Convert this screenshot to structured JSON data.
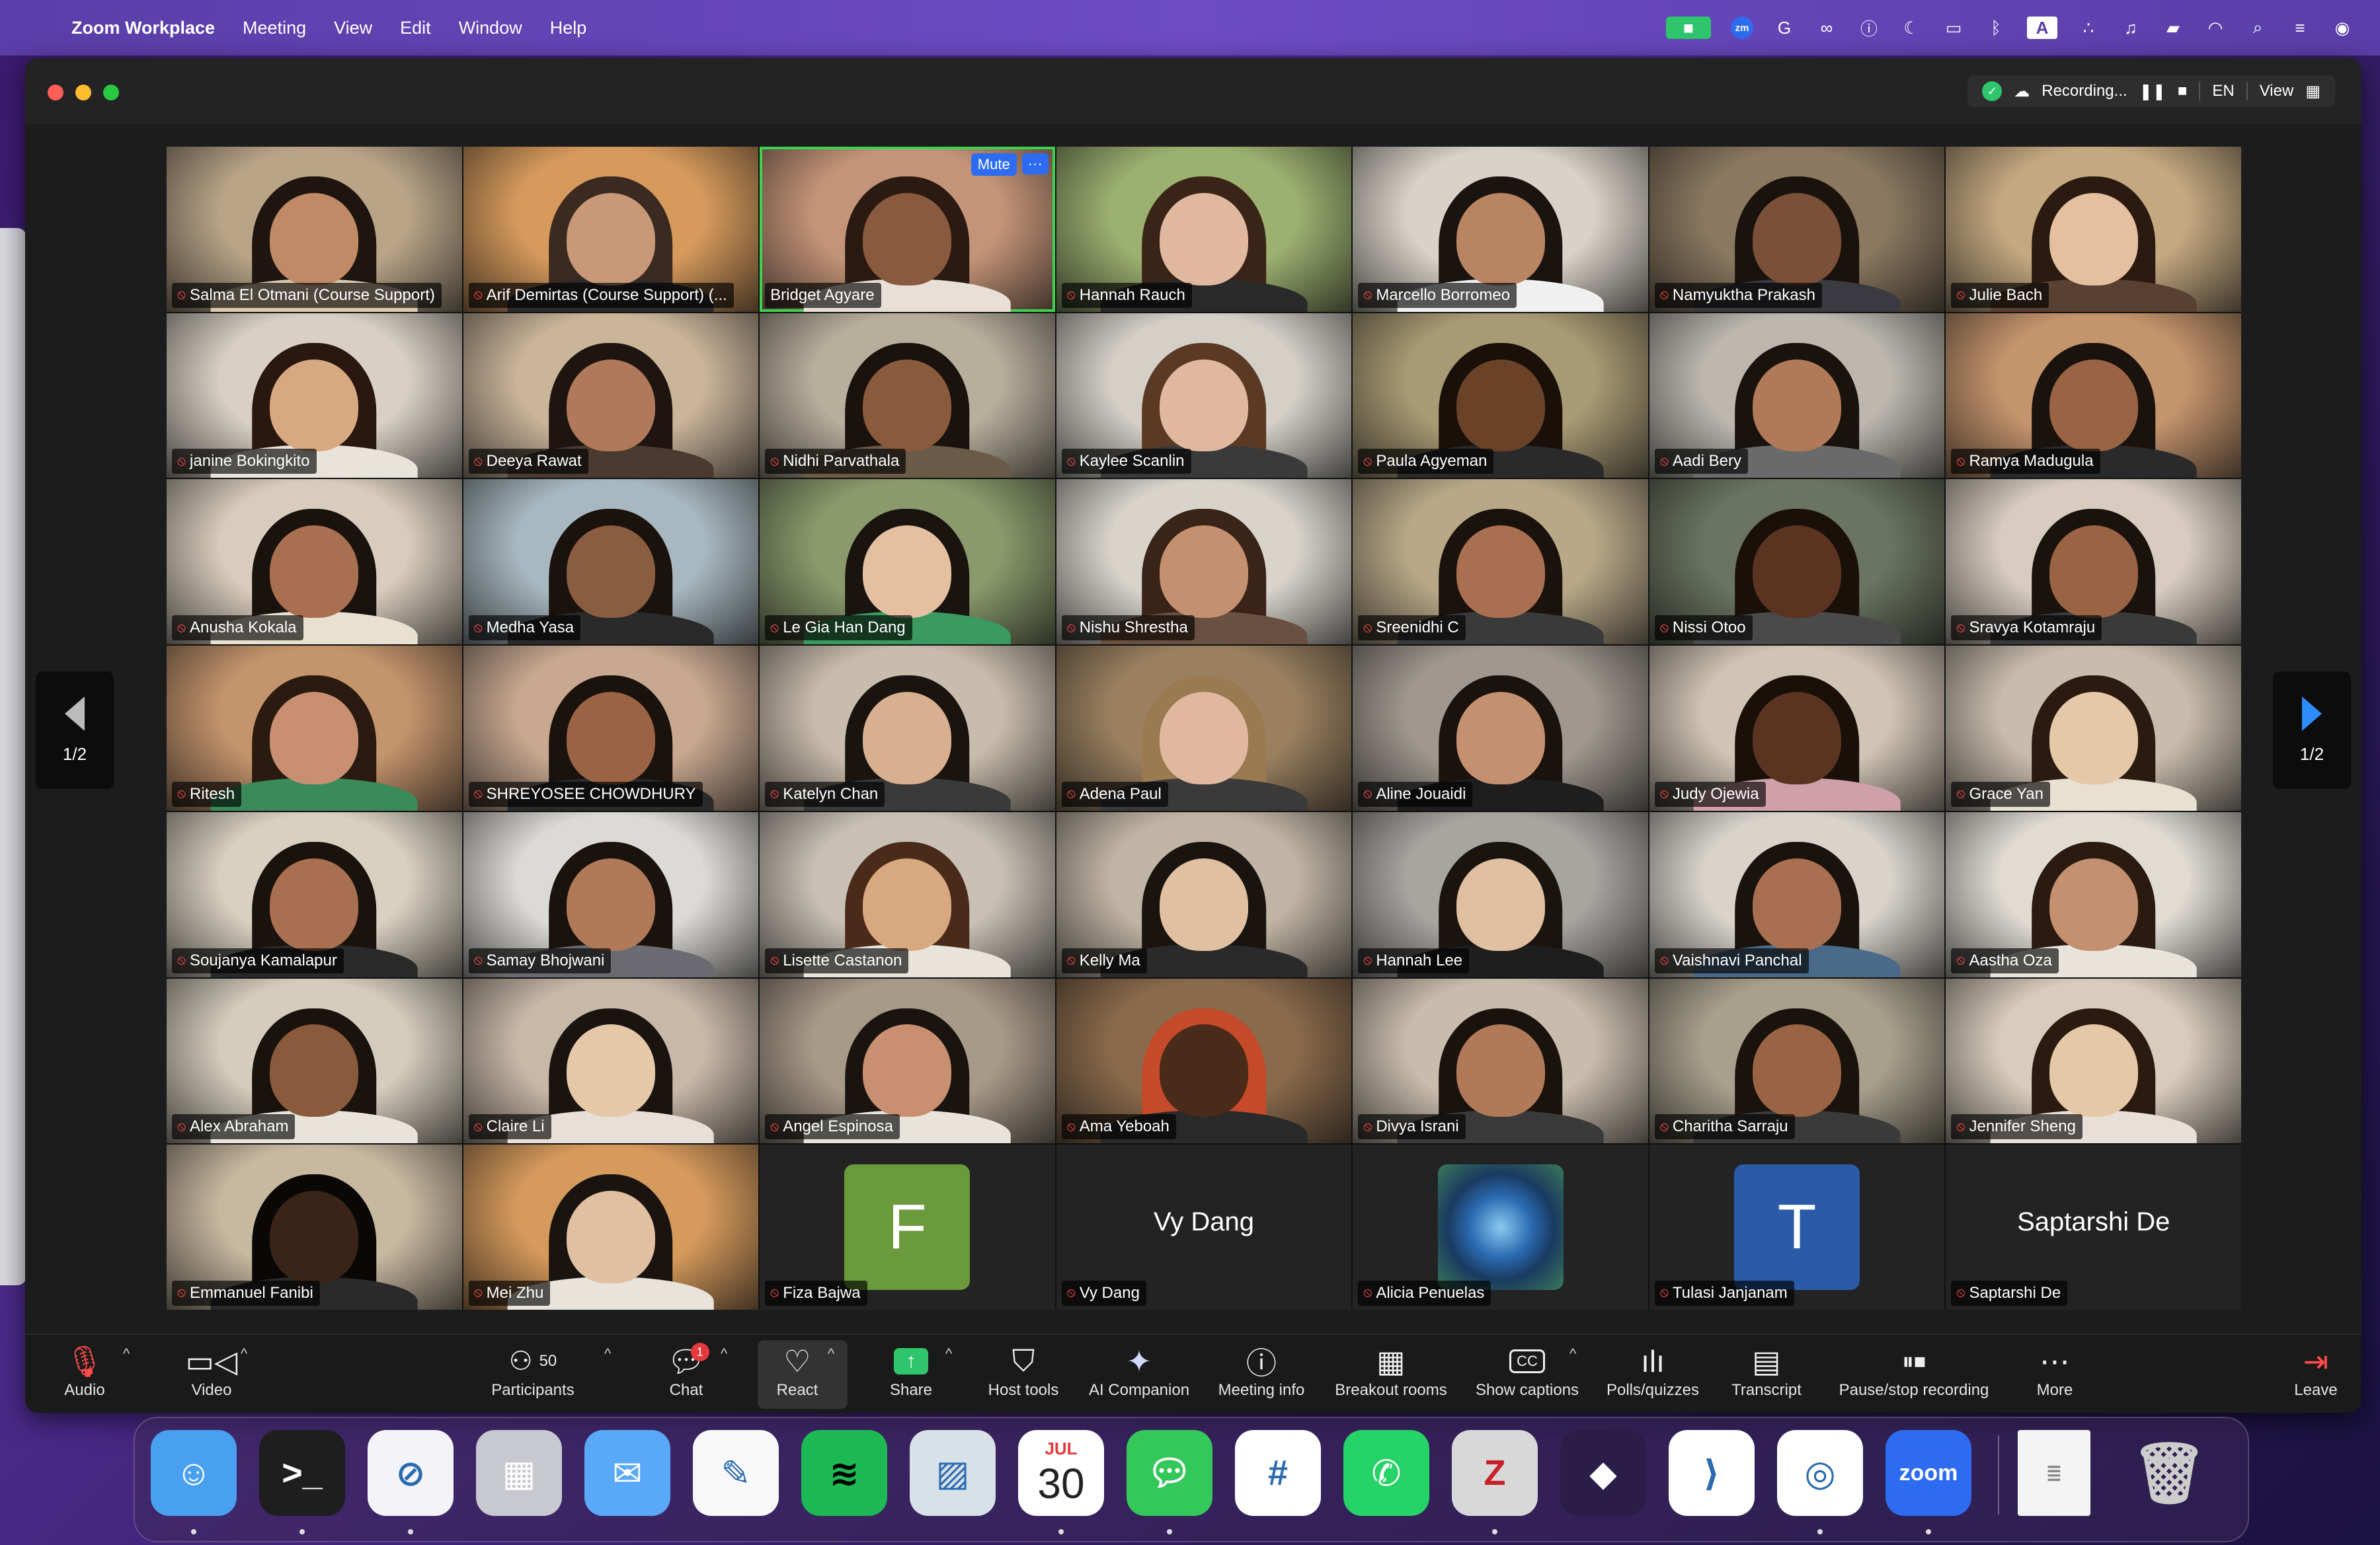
{
  "menubar": {
    "app_name": "Zoom Workplace",
    "menus": [
      "Meeting",
      "View",
      "Edit",
      "Window",
      "Help"
    ],
    "zoom_badge": "zm",
    "keyboard_indicator": "A"
  },
  "window": {
    "recording_label": "Recording...",
    "language": "EN",
    "view_label": "View",
    "page_indicator_left": "1/2",
    "page_indicator_right": "1/2"
  },
  "participants": [
    {
      "name": "Salma El Otmani (Course Support)",
      "bg": "#b9a488",
      "skin": "#c08a66",
      "hair": "#1e1410",
      "shirt": "#d9c9b0"
    },
    {
      "name": "Arif Demirtas (Course Support) (...",
      "bg": "#d69a5c",
      "skin": "#c89878",
      "hair": "#3a2a20",
      "shirt": "#2c2c2c"
    },
    {
      "name": "Bridget Agyare",
      "bg": "#c49478",
      "skin": "#8a5a3e",
      "hair": "#2a1a12",
      "shirt": "#e8e0d8",
      "active": true,
      "mute_label": "Mute",
      "more_label": "···"
    },
    {
      "name": "Hannah Rauch",
      "bg": "#9cb070",
      "skin": "#e0b8a0",
      "hair": "#3a2418",
      "shirt": "#2a2a2a"
    },
    {
      "name": "Marcello Borromeo",
      "bg": "#d8d2c8",
      "skin": "#b88462",
      "hair": "#1a1410",
      "shirt": "#f0f0f0"
    },
    {
      "name": "Namyuktha Prakash",
      "bg": "#8a7860",
      "skin": "#7a5038",
      "hair": "#1a120c",
      "shirt": "#3a3a40"
    },
    {
      "name": "Julie Bach",
      "bg": "#c4a880",
      "skin": "#e4c0a0",
      "hair": "#2a1a10",
      "shirt": "#5a4030"
    },
    {
      "name": "janine Bokingkito",
      "bg": "#d8d0c4",
      "skin": "#d8a880",
      "hair": "#2a1810",
      "shirt": "#e8e4dc"
    },
    {
      "name": "Deeya Rawat",
      "bg": "#cab49a",
      "skin": "#b07a5a",
      "hair": "#1e1410",
      "shirt": "#4a3a30"
    },
    {
      "name": "Nidhi Parvathala",
      "bg": "#b8ae9c",
      "skin": "#8a5a3c",
      "hair": "#1a120c",
      "shirt": "#6a5a48"
    },
    {
      "name": "Kaylee Scanlin",
      "bg": "#d4d0c8",
      "skin": "#e0b8a0",
      "hair": "#5a3a24",
      "shirt": "#3a3a3a"
    },
    {
      "name": "Paula Agyeman",
      "bg": "#a89a74",
      "skin": "#6a4228",
      "hair": "#1a100a",
      "shirt": "#2a2a2a"
    },
    {
      "name": "Aadi Bery",
      "bg": "#bcb8b0",
      "skin": "#b07a58",
      "hair": "#1a120c",
      "shirt": "#6a6a6a"
    },
    {
      "name": "Ramya Madugula",
      "bg": "#c4946c",
      "skin": "#9a6444",
      "hair": "#1a120c",
      "shirt": "#2a2a2a"
    },
    {
      "name": "Anusha Kokala",
      "bg": "#d8ccbc",
      "skin": "#a87050",
      "hair": "#1a120c",
      "shirt": "#e8e0d0"
    },
    {
      "name": "Medha Yasa",
      "bg": "#a8b8c0",
      "skin": "#8a5c40",
      "hair": "#1a120c",
      "shirt": "#2a2a2a"
    },
    {
      "name": "Le Gia Han Dang",
      "bg": "#8a9a6c",
      "skin": "#e4c0a0",
      "hair": "#1a1410",
      "shirt": "#3a9a60"
    },
    {
      "name": "Nishu Shrestha",
      "bg": "#d8d4cc",
      "skin": "#c49070",
      "hair": "#3a2418",
      "shirt": "#6a5040"
    },
    {
      "name": "Sreenidhi C",
      "bg": "#b8a888",
      "skin": "#a87050",
      "hair": "#1a120c",
      "shirt": "#3a3a3a"
    },
    {
      "name": "Nissi Otoo",
      "bg": "#6a7460",
      "skin": "#5a3420",
      "hair": "#1a100a",
      "shirt": "#4a4a4a"
    },
    {
      "name": "Sravya Kotamraju",
      "bg": "#d8ccc0",
      "skin": "#9a6444",
      "hair": "#1a120c",
      "shirt": "#3a3a3a"
    },
    {
      "name": "Ritesh",
      "bg": "#c4946c",
      "skin": "#c89070",
      "hair": "#2a1a10",
      "shirt": "#3a8a5a"
    },
    {
      "name": "SHREYOSEE CHOWDHURY",
      "bg": "#c8a890",
      "skin": "#9a6444",
      "hair": "#1a120c",
      "shirt": "#2a2a2a"
    },
    {
      "name": "Katelyn Chan",
      "bg": "#c8bcac",
      "skin": "#d8b090",
      "hair": "#1a1410",
      "shirt": "#3a3a3a"
    },
    {
      "name": "Adena Paul",
      "bg": "#9a8060",
      "skin": "#e0b8a0",
      "hair": "#9a7a50",
      "shirt": "#3a3a3a"
    },
    {
      "name": "Aline Jouaidi",
      "bg": "#a09890",
      "skin": "#c49070",
      "hair": "#1a120c",
      "shirt": "#1e1e1e"
    },
    {
      "name": "Judy Ojewia",
      "bg": "#d0c4b4",
      "skin": "#5a3420",
      "hair": "#1a100a",
      "shirt": "#d0a0a8"
    },
    {
      "name": "Grace Yan",
      "bg": "#c8bcac",
      "skin": "#e4c8a8",
      "hair": "#2a1a10",
      "shirt": "#e8e0d0"
    },
    {
      "name": "Soujanya Kamalapur",
      "bg": "#d8d0c0",
      "skin": "#a87050",
      "hair": "#1a120c",
      "shirt": "#2a2a2a"
    },
    {
      "name": "Samay Bhojwani",
      "bg": "#dcdad6",
      "skin": "#b07a58",
      "hair": "#1a120c",
      "shirt": "#6a6a70"
    },
    {
      "name": "Lisette Castanon",
      "bg": "#c8c0b4",
      "skin": "#d8a880",
      "hair": "#4a2a18",
      "shirt": "#e8e4dc"
    },
    {
      "name": "Kelly Ma",
      "bg": "#c0b4a4",
      "skin": "#e0c0a0",
      "hair": "#1a1410",
      "shirt": "#2a2a2a"
    },
    {
      "name": "Hannah Lee",
      "bg": "#a8a4a0",
      "skin": "#e0c0a0",
      "hair": "#1a1410",
      "shirt": "#1e1e1e"
    },
    {
      "name": "Vaishnavi Panchal",
      "bg": "#d8d4cc",
      "skin": "#a87050",
      "hair": "#1a120c",
      "shirt": "#4a6a8a"
    },
    {
      "name": "Aastha Oza",
      "bg": "#e0dcd4",
      "skin": "#c49070",
      "hair": "#2a1a10",
      "shirt": "#e8e4dc"
    },
    {
      "name": "Alex Abraham",
      "bg": "#d4ccbc",
      "skin": "#8a5a3c",
      "hair": "#1a120c",
      "shirt": "#e8e4dc"
    },
    {
      "name": "Claire Li",
      "bg": "#c8b8a8",
      "skin": "#e4c8a8",
      "hair": "#1a1410",
      "shirt": "#e8e0d8"
    },
    {
      "name": "Angel Espinosa",
      "bg": "#a89a88",
      "skin": "#c89070",
      "hair": "#1a1410",
      "shirt": "#e8e4dc"
    },
    {
      "name": "Ama Yeboah",
      "bg": "#8a6a4c",
      "skin": "#4a2a18",
      "hair": "#c44a2a",
      "shirt": "#2a2a2a"
    },
    {
      "name": "Divya Israni",
      "bg": "#c8bcac",
      "skin": "#b07a58",
      "hair": "#1a120c",
      "shirt": "#3a3a3a"
    },
    {
      "name": "Charitha Sarraju",
      "bg": "#a8a08c",
      "skin": "#9a6444",
      "hair": "#1a120c",
      "shirt": "#3a3a3a"
    },
    {
      "name": "Jennifer Sheng",
      "bg": "#d8ccbc",
      "skin": "#e4c8a8",
      "hair": "#2a1a10",
      "shirt": "#e8e0d8"
    },
    {
      "name": "Emmanuel Fanibi",
      "bg": "#c8b8a0",
      "skin": "#3a2418",
      "hair": "#0a0806",
      "shirt": "#2a2a2a"
    },
    {
      "name": "Mei Zhu",
      "bg": "#d69a5c",
      "skin": "#e0c0a0",
      "hair": "#1a1410",
      "shirt": "#e8e4dc"
    },
    {
      "name": "Fiza Bajwa",
      "novideo": true,
      "avatar_letter": "F",
      "avatar_color": "#6a9a3c"
    },
    {
      "name": "Vy Dang",
      "novideo": true,
      "display_name": "Vy Dang"
    },
    {
      "name": "Alicia Penuelas",
      "novideo": true,
      "avatar_image": true
    },
    {
      "name": "Tulasi Janjanam",
      "novideo": true,
      "avatar_letter": "T",
      "avatar_color": "#2a5aa8"
    },
    {
      "name": "Saptarshi De",
      "novideo": true,
      "display_name": "Saptarshi De"
    }
  ],
  "toolbar": {
    "audio": "Audio",
    "video": "Video",
    "participants": "Participants",
    "participants_count": "50",
    "chat": "Chat",
    "chat_badge": "1",
    "react": "React",
    "share": "Share",
    "host_tools": "Host tools",
    "ai_companion": "AI Companion",
    "meeting_info": "Meeting info",
    "breakout_rooms": "Breakout rooms",
    "show_captions": "Show captions",
    "cc_icon": "CC",
    "polls": "Polls/quizzes",
    "transcript": "Transcript",
    "pause_stop": "Pause/stop recording",
    "more": "More",
    "leave": "Leave"
  },
  "dock": {
    "calendar_month": "JUL",
    "calendar_day": "30",
    "zoom_label": "zoom",
    "apps": [
      {
        "name": "finder-app",
        "color": "#4aa0f0"
      },
      {
        "name": "terminal-app",
        "color": "#1e1e1e"
      },
      {
        "name": "safari-app",
        "color": "#f4f4f8"
      },
      {
        "name": "launchpad-app",
        "color": "#c8c8d0"
      },
      {
        "name": "mail-app",
        "color": "#5aa8f8"
      },
      {
        "name": "freeform-app",
        "color": "#f8f8f8"
      },
      {
        "name": "spotify-app",
        "color": "#1db954"
      },
      {
        "name": "preview-app",
        "color": "#d8e0e8"
      },
      {
        "name": "calendar-app",
        "color": "#ffffff"
      },
      {
        "name": "messages-app",
        "color": "#34c759"
      },
      {
        "name": "slack-app",
        "color": "#ffffff"
      },
      {
        "name": "whatsapp-app",
        "color": "#25d366"
      },
      {
        "name": "zotero-app",
        "color": "#d8d8d8"
      },
      {
        "name": "obsidian-app",
        "color": "#2a1e48"
      },
      {
        "name": "vscode-app",
        "color": "#ffffff"
      },
      {
        "name": "chrome-app",
        "color": "#ffffff"
      },
      {
        "name": "zoom-app",
        "color": "#2d6cf0"
      }
    ]
  }
}
